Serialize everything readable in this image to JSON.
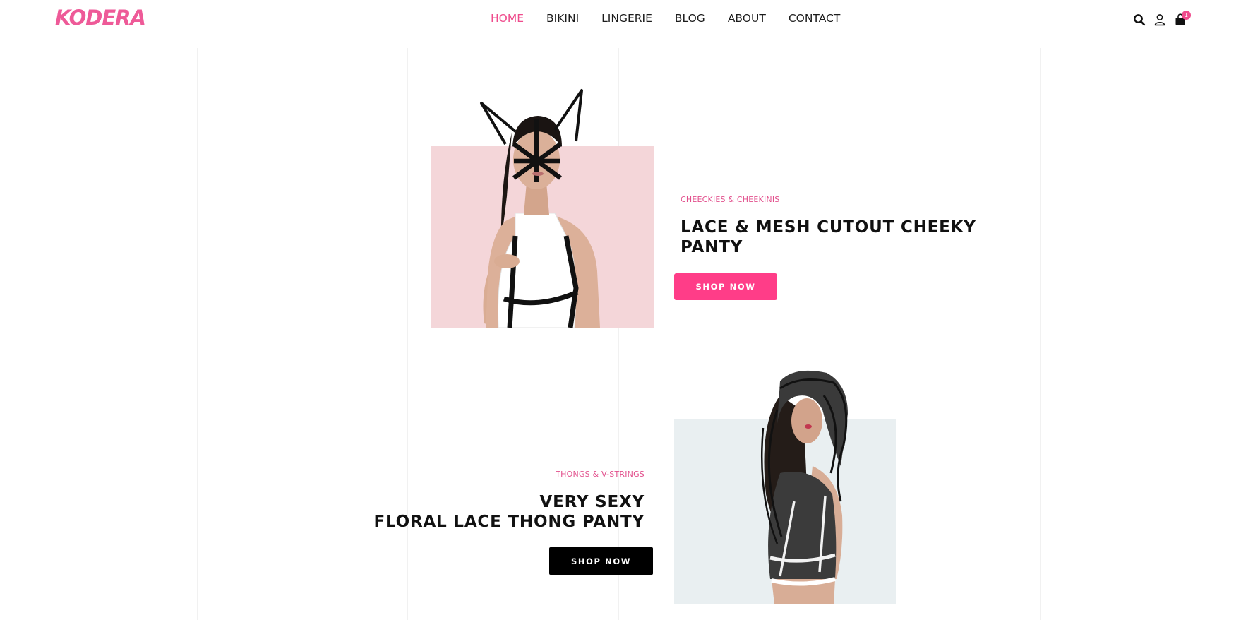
{
  "brand": {
    "logo_text": "KODERA",
    "accent": "#ef4b8c"
  },
  "nav": {
    "items": [
      {
        "label": "HOME",
        "active": true
      },
      {
        "label": "BIKINI",
        "active": false
      },
      {
        "label": "LINGERIE",
        "active": false
      },
      {
        "label": "BLOG",
        "active": false
      },
      {
        "label": "ABOUT",
        "active": false
      },
      {
        "label": "CONTACT",
        "active": false
      }
    ]
  },
  "header_icons": {
    "search": "search-icon",
    "account": "user-icon",
    "cart": "shopping-bag-icon",
    "cart_count": "1"
  },
  "banners": [
    {
      "category": "CHEECKIES & CHEEKINIS",
      "title_line1": "LACE & MESH CUTOUT CHEEKY",
      "title_line2": "PANTY",
      "button_label": "SHOP NOW",
      "image_bg": "#f4d6d9",
      "button_color": "#ff3d88"
    },
    {
      "category": "THONGS & V-STRINGS",
      "title_line1": "VERY SEXY",
      "title_line2": "FLORAL LACE THONG PANTY",
      "button_label": "SHOP NOW",
      "image_bg": "#e9eff1",
      "button_color": "#000000"
    }
  ]
}
